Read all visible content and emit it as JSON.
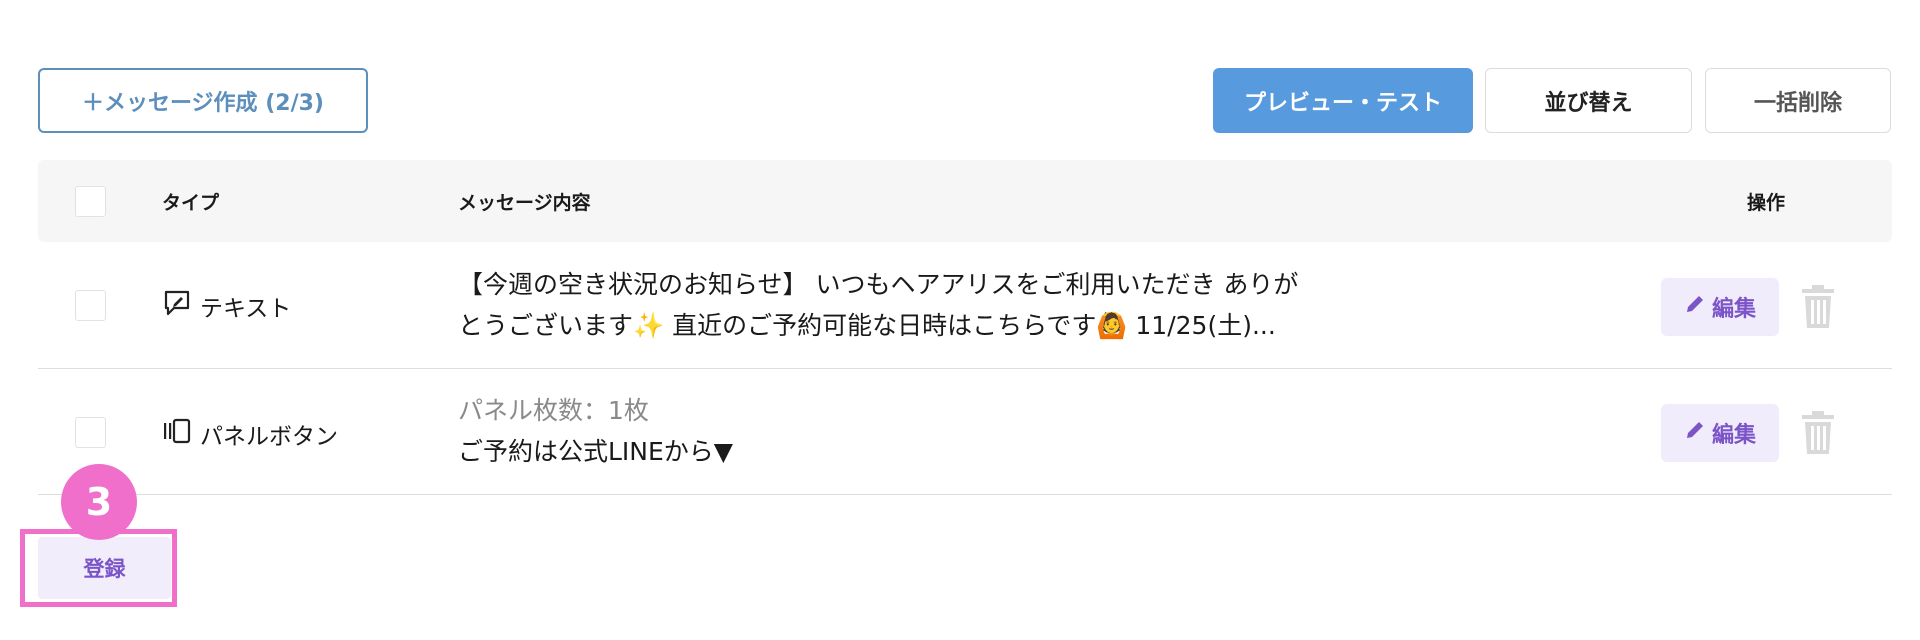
{
  "toolbar": {
    "create_label": "＋メッセージ作成 (2/3)",
    "preview_label": "プレビュー・テスト",
    "sort_label": "並び替え",
    "bulk_delete_label": "一括削除"
  },
  "table": {
    "headers": {
      "type": "タイプ",
      "content": "メッセージ内容",
      "actions": "操作"
    },
    "rows": [
      {
        "type_icon": "chat-bubble-edit-icon",
        "type_label": "テキスト",
        "content_line1": "【今週の空き状況のお知らせ】 いつもヘアアリスをご利用いただき ありが",
        "content_line2": "とうございます✨ 直近のご予約可能な日時はこちらです🙆 11/25(土)...",
        "edit_label": "編集"
      },
      {
        "type_icon": "panel-carousel-icon",
        "type_label": "パネルボタン",
        "content_sub": "パネル枚数：1枚",
        "content_line1": "ご予約は公式LINEから▼",
        "edit_label": "編集"
      }
    ]
  },
  "footer": {
    "register_label": "登録",
    "step_number": "3"
  },
  "colors": {
    "primary_blue": "#579ade",
    "outline_blue": "#5d8fbd",
    "purple": "#7b55c8",
    "purple_bg": "#f1ecfb",
    "annotation_pink": "#f06fcb"
  }
}
